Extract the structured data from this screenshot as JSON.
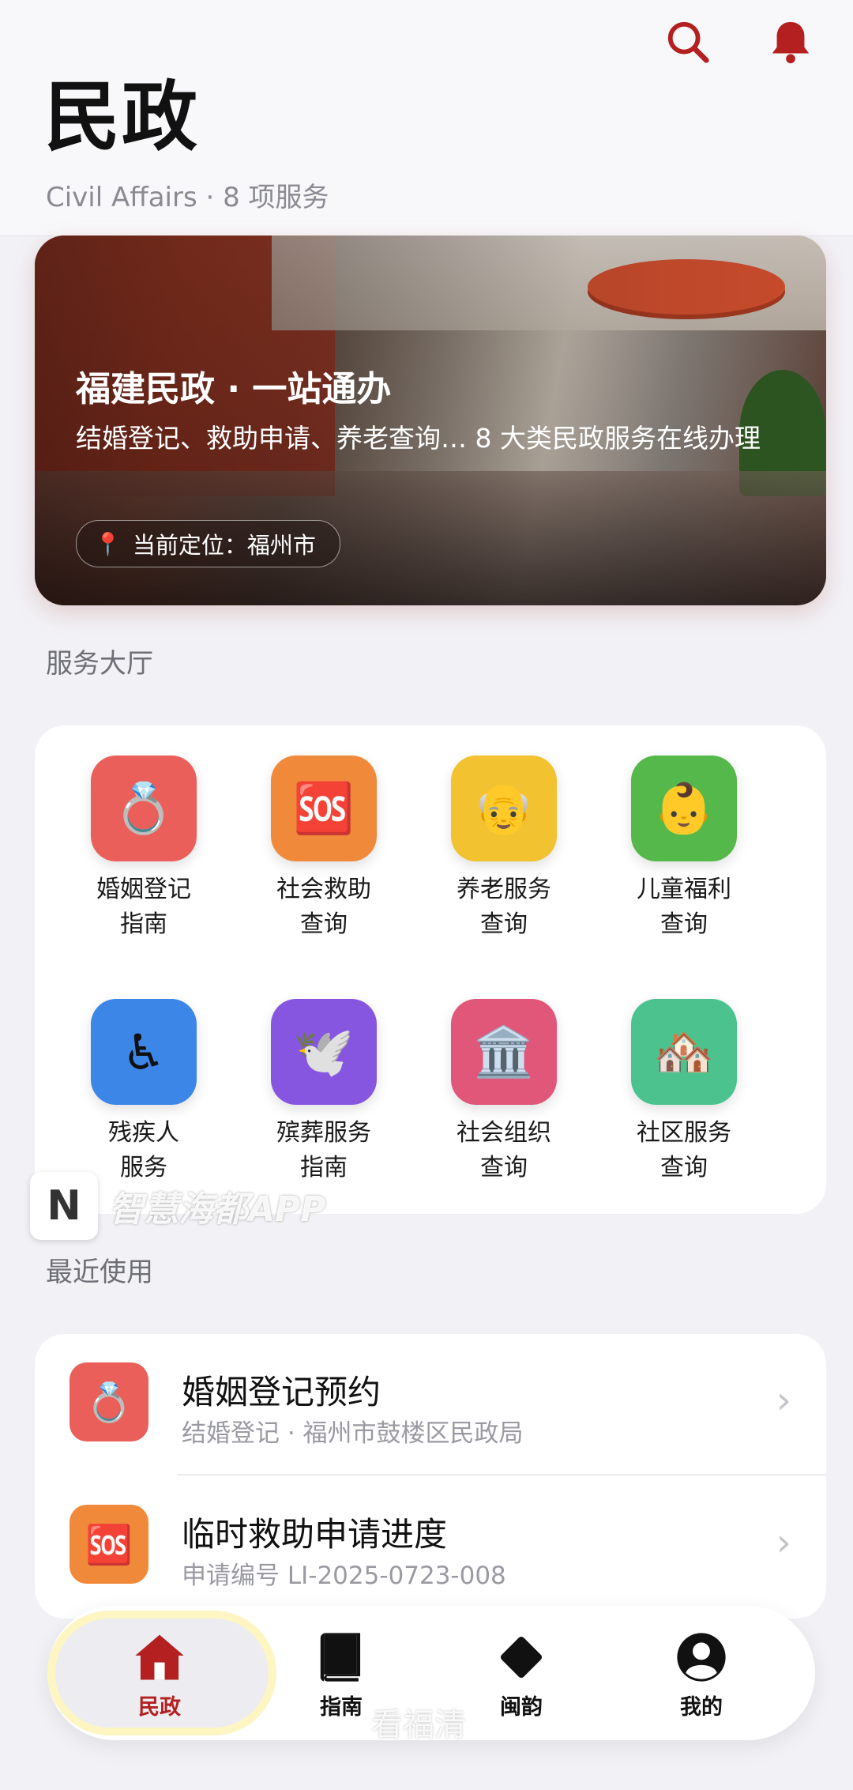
{
  "header": {
    "title": "民政",
    "subtitle": "Civil Affairs · 8 项服务",
    "accent": "#b3201f"
  },
  "hero": {
    "title": "福建民政 · 一站通办",
    "description": "结婚登记、救助申请、养老查询… 8 大类民政服务在线办理",
    "location": "当前定位：福州市"
  },
  "sections": {
    "services": "服务大厅",
    "recent": "最近使用"
  },
  "services": [
    {
      "label": "婚姻登记\n指南",
      "icon": "ring-icon",
      "glyph": "💍",
      "color": "#ea5f5a"
    },
    {
      "label": "社会救助\n查询",
      "icon": "sos-icon",
      "glyph": "🆘",
      "color": "#f08a3a"
    },
    {
      "label": "养老服务\n查询",
      "icon": "elder-icon",
      "glyph": "👴",
      "color": "#f2c230"
    },
    {
      "label": "儿童福利\n查询",
      "icon": "baby-icon",
      "glyph": "👶",
      "color": "#55b84a"
    },
    {
      "label": "残疾人\n服务",
      "icon": "wheelchair-icon",
      "glyph": "♿",
      "color": "#3c86e8"
    },
    {
      "label": "殡葬服务\n指南",
      "icon": "dove-icon",
      "glyph": "🕊️",
      "color": "#8656e0"
    },
    {
      "label": "社会组织\n查询",
      "icon": "institution-icon",
      "glyph": "🏛️",
      "color": "#e0577a"
    },
    {
      "label": "社区服务\n查询",
      "icon": "houses-icon",
      "glyph": "🏘️",
      "color": "#4cc38e"
    }
  ],
  "recent": [
    {
      "title": "婚姻登记预约",
      "subtitle": "结婚登记 · 福州市鼓楼区民政局",
      "icon": "ring-icon",
      "glyph": "💍",
      "color": "#ea5f5a"
    },
    {
      "title": "临时救助申请进度",
      "subtitle": "申请编号 LI-2025-0723-008",
      "icon": "sos-icon",
      "glyph": "🆘",
      "color": "#f08a3a"
    }
  ],
  "tabs": [
    {
      "label": "民政",
      "icon": "home-icon",
      "active": true
    },
    {
      "label": "指南",
      "icon": "book-icon",
      "active": false
    },
    {
      "label": "闽韵",
      "icon": "diamond-icon",
      "active": false
    },
    {
      "label": "我的",
      "icon": "profile-icon",
      "active": false
    }
  ],
  "watermarks": {
    "app": "智慧海都APP",
    "logo_letter": "N",
    "site": "看福清"
  }
}
